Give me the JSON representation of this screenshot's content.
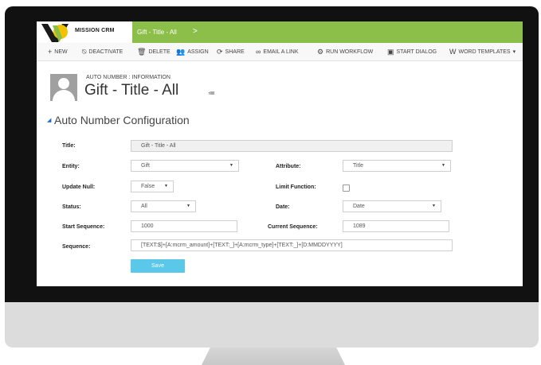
{
  "app": {
    "logo_text": "MISSION CRM",
    "breadcrumb": "Gift - Title - All",
    "breadcrumb_chevron": ">"
  },
  "commands": [
    {
      "label": "NEW",
      "icon": "plus-icon",
      "glyph": "+"
    },
    {
      "label": "DEACTIVATE",
      "icon": "deactivate-icon",
      "glyph": "⍉"
    },
    {
      "label": "DELETE",
      "icon": "trash-icon",
      "glyph": "🗑"
    },
    {
      "label": "ASSIGN",
      "icon": "assign-icon",
      "glyph": "👥"
    },
    {
      "label": "SHARE",
      "icon": "share-icon",
      "glyph": "⟳"
    },
    {
      "label": "EMAIL A LINK",
      "icon": "link-icon",
      "glyph": "∞"
    },
    {
      "label": "RUN WORKFLOW",
      "icon": "workflow-icon",
      "glyph": "⚙"
    },
    {
      "label": "START DIALOG",
      "icon": "dialog-icon",
      "glyph": "▣"
    },
    {
      "label": "WORD TEMPLATES",
      "icon": "word-icon",
      "glyph": "W"
    }
  ],
  "more_glyph": "▾",
  "header": {
    "entity_label": "AUTO NUMBER : INFORMATION",
    "title": "Gift - Title - All",
    "menu_glyph": "≔"
  },
  "section": {
    "caret": "◢",
    "title": "Auto Number Configuration"
  },
  "form": {
    "title_label": "Title:",
    "title_value": "Gift - Title - All",
    "entity_label": "Entity:",
    "entity_value": "Gift",
    "attribute_label": "Attribute:",
    "attribute_value": "Title",
    "update_null_label": "Update Null:",
    "update_null_value": "False",
    "limit_function_label": "Limit Function:",
    "limit_function_checked": false,
    "status_label": "Status:",
    "status_value": "All",
    "date_label": "Date:",
    "date_value": "Date",
    "start_sequence_label": "Start Sequence:",
    "start_sequence_value": "1000",
    "current_sequence_label": "Current Sequence:",
    "current_sequence_value": "1089",
    "sequence_label": "Sequence:",
    "sequence_value": "[TEXT:$]+[A:mcrm_amount]+[TEXT:_]+[A:mcrm_type]+[TEXT:_]+[D:MMDDYYYY]",
    "save_label": "Save"
  },
  "colors": {
    "nav_green": "#8cbe4a",
    "save_blue": "#5bc8ea",
    "caret_blue": "#1d6cc9"
  }
}
